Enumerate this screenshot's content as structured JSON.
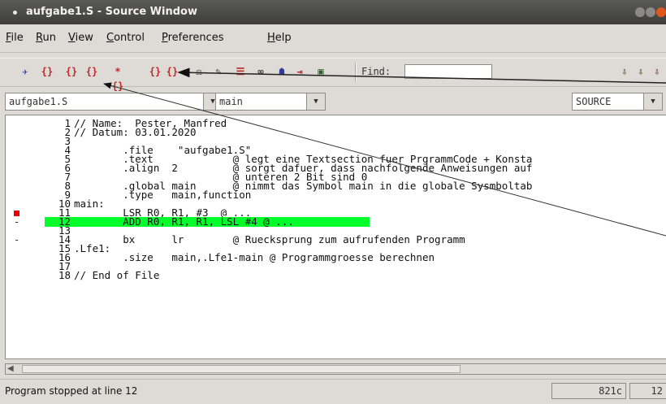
{
  "window": {
    "title": "aufgabe1.S - Source Window"
  },
  "menu": [
    {
      "underline": "F",
      "rest": "ile"
    },
    {
      "underline": "R",
      "rest": "un"
    },
    {
      "underline": "V",
      "rest": "iew"
    },
    {
      "underline": "C",
      "rest": "ontrol"
    },
    {
      "underline": "P",
      "rest": "references"
    },
    {
      "underline": "H",
      "rest": "elp"
    }
  ],
  "toolbar": {
    "buttons": [
      {
        "icon": "run-icon",
        "glyph": "✈",
        "color": "#2b3c9a"
      },
      {
        "icon": "step-icon",
        "glyph": "{}",
        "color": "#c0292b"
      },
      {
        "icon": "next-icon",
        "glyph": "{}",
        "color": "#c0292b"
      },
      {
        "icon": "finish-icon",
        "glyph": "{}",
        "color": "#c0292b"
      },
      {
        "icon": "continue-icon",
        "glyph": "*{}",
        "color": "#c0292b"
      },
      {
        "icon": "stepi-icon",
        "glyph": "{}",
        "color": "#c0292b"
      },
      {
        "icon": "nexti-icon",
        "glyph": "{}",
        "color": "#c0292b"
      },
      {
        "icon": "up-stack-icon",
        "glyph": "⚖",
        "color": "#4a4a4a"
      },
      {
        "icon": "breakpoint-icon",
        "glyph": "✎",
        "color": "#4a4a4a"
      },
      {
        "icon": "stack-icon",
        "glyph": "☰",
        "color": "#c0292b"
      },
      {
        "icon": "watch-icon",
        "glyph": "∞",
        "color": "#4a4a4a"
      },
      {
        "icon": "locals-icon",
        "glyph": "☗",
        "color": "#2b3c9a"
      },
      {
        "icon": "registers-icon",
        "glyph": "⇥",
        "color": "#c0292b"
      },
      {
        "icon": "memory-icon",
        "glyph": "▣",
        "color": "#2f5c2f"
      }
    ],
    "find_label": "Find:",
    "find_value": "",
    "right_buttons": [
      {
        "icon": "down-frame-icon",
        "glyph": "⇩"
      },
      {
        "icon": "up-frame-icon",
        "glyph": "⇩"
      },
      {
        "icon": "bottom-frame-icon",
        "glyph": "⇩"
      }
    ]
  },
  "combos": {
    "file": "aufgabe1.S",
    "function": "main",
    "mode": "SOURCE"
  },
  "source": {
    "highlight_color": "#00ff2a",
    "lines": [
      {
        "n": "1",
        "code": "// Name:  Pester, Manfred",
        "mark": ""
      },
      {
        "n": "2",
        "code": "// Datum: 03.01.2020",
        "mark": ""
      },
      {
        "n": "3",
        "code": "",
        "mark": ""
      },
      {
        "n": "4",
        "code": "        .file    \"aufgabe1.S\"",
        "mark": ""
      },
      {
        "n": "5",
        "code": "        .text             @ legt eine Textsection fuer PrgrammCode + Konsta",
        "mark": ""
      },
      {
        "n": "6",
        "code": "        .align  2         @ sorgt dafuer, dass nachfolgende Anweisungen auf",
        "mark": ""
      },
      {
        "n": "7",
        "code": "                          @ unteren 2 Bit sind 0",
        "mark": ""
      },
      {
        "n": "8",
        "code": "        .global main      @ nimmt das Symbol main in die globale Sysmboltab",
        "mark": ""
      },
      {
        "n": "9",
        "code": "        .type   main,function",
        "mark": ""
      },
      {
        "n": "10",
        "code": "main:",
        "mark": ""
      },
      {
        "n": "11",
        "code": "        LSR R0, R1, #3  @ ...",
        "mark": "breakpoint"
      },
      {
        "n": "12",
        "code": "        ADD R0, R1, R1, LSL #4 @ ...",
        "mark": "dash",
        "current": true
      },
      {
        "n": "13",
        "code": "",
        "mark": ""
      },
      {
        "n": "14",
        "code": "        bx      lr        @ Ruecksprung zum aufrufenden Programm",
        "mark": "dash"
      },
      {
        "n": "15",
        "code": ".Lfe1:",
        "mark": ""
      },
      {
        "n": "16",
        "code": "        .size   main,.Lfe1-main @ Programmgroesse berechnen",
        "mark": ""
      },
      {
        "n": "17",
        "code": "",
        "mark": ""
      },
      {
        "n": "18",
        "code": "// End of File",
        "mark": ""
      }
    ]
  },
  "status": {
    "message": "Program stopped at line 12",
    "address": "821c",
    "line": "12"
  }
}
